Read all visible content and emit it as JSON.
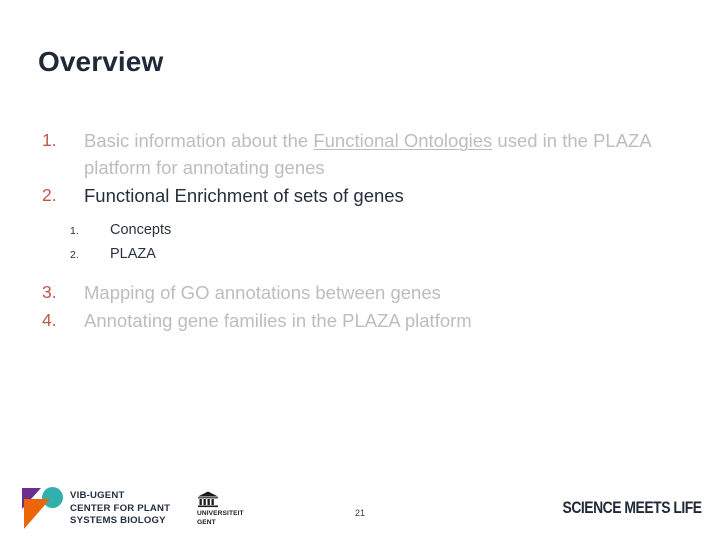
{
  "slide": {
    "title": "Overview",
    "page_number": "21",
    "background_color": "#ffffff",
    "title_color": "#1f2937",
    "number_color": "#c0564a",
    "dim_text_color": "#bdbdbd",
    "strong_text_color": "#262f3d"
  },
  "outline": {
    "items": [
      {
        "number": "1.",
        "emphasis": "dim",
        "text_before": "Basic information about the ",
        "text_underlined": "Functional Ontologies",
        "text_after": " used in the PLAZA platform for annotating genes"
      },
      {
        "number": "2.",
        "emphasis": "strong",
        "text_before": "Functional Enrichment of sets of genes",
        "text_underlined": "",
        "text_after": ""
      },
      {
        "number": "3.",
        "emphasis": "dim",
        "text_before": "Mapping of GO annotations between genes",
        "text_underlined": "",
        "text_after": ""
      },
      {
        "number": "4.",
        "emphasis": "dim",
        "text_before": "Annotating gene families in the PLAZA platform",
        "text_underlined": "",
        "text_after": ""
      }
    ],
    "sub_items": [
      {
        "number": "1.",
        "label": "Concepts"
      },
      {
        "number": "2.",
        "label": "PLAZA"
      }
    ]
  },
  "footer": {
    "vib_logo": {
      "line1": "VIB-UGENT",
      "line2": "CENTER FOR PLANT",
      "line3": "SYSTEMS BIOLOGY",
      "purple": "#6b2f8f",
      "teal": "#31b0ae",
      "orange": "#ec6608"
    },
    "ugent_logo": {
      "line1": "UNIVERSITEIT",
      "line2": "GENT"
    },
    "tagline": "SCIENCE MEETS LIFE"
  }
}
